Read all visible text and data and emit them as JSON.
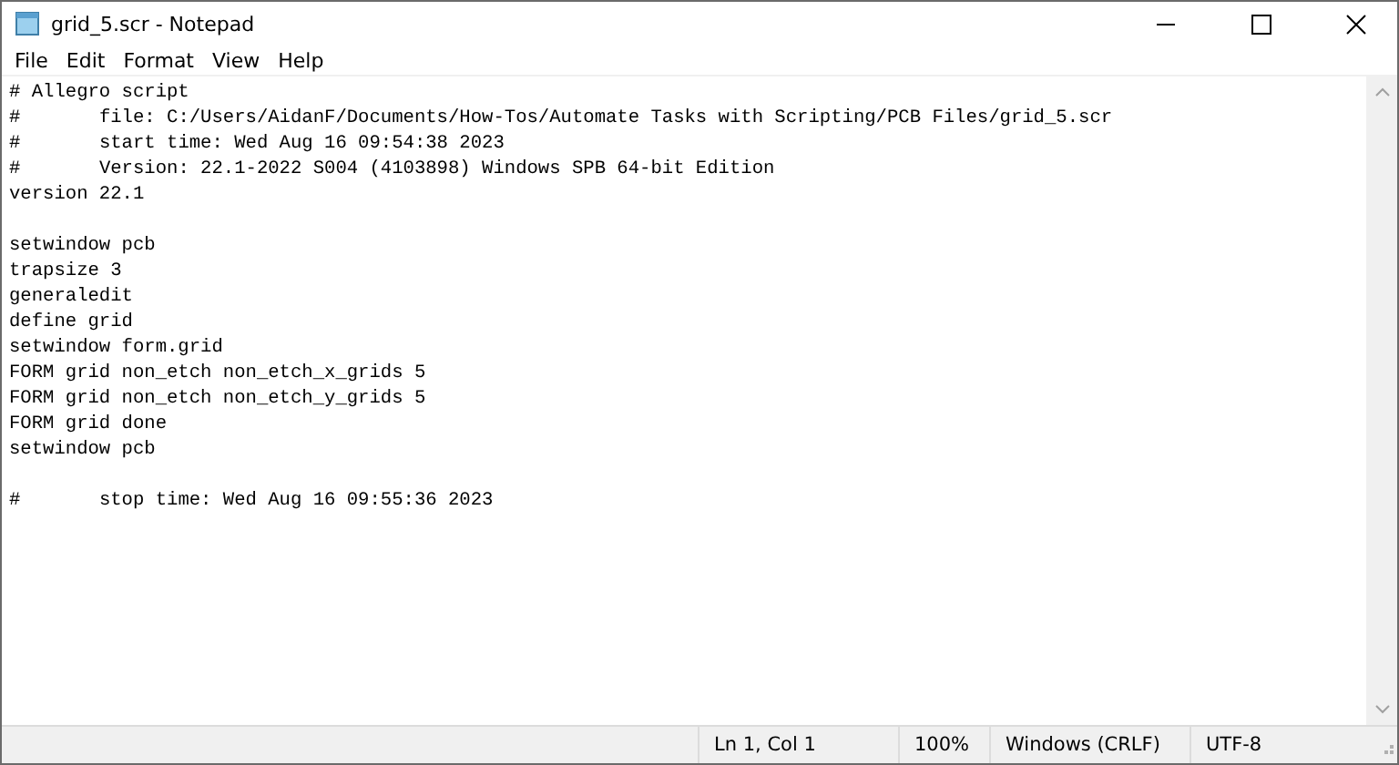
{
  "window": {
    "title": "grid_5.scr - Notepad"
  },
  "menu": [
    "File",
    "Edit",
    "Format",
    "View",
    "Help"
  ],
  "editor": {
    "blocks": [
      [
        "# Allegro script",
        "#\tfile: C:/Users/AidanF/Documents/How-Tos/Automate Tasks with Scripting/PCB Files/grid_5.scr",
        "#\tstart time: Wed Aug 16 09:54:38 2023",
        "#\tVersion: 22.1-2022 S004 (4103898) Windows SPB 64-bit Edition",
        "version 22.1"
      ],
      [
        "setwindow pcb",
        "trapsize 3",
        "generaledit",
        "define grid",
        "setwindow form.grid",
        "FORM grid non_etch non_etch_x_grids 5",
        "FORM grid non_etch non_etch_y_grids 5",
        "FORM grid done",
        "setwindow pcb"
      ],
      [
        "#\tstop time: Wed Aug 16 09:55:36 2023"
      ]
    ]
  },
  "status_bar": [
    "Ln 1, Col 1",
    "100%",
    "Windows (CRLF)",
    "UTF-8"
  ]
}
